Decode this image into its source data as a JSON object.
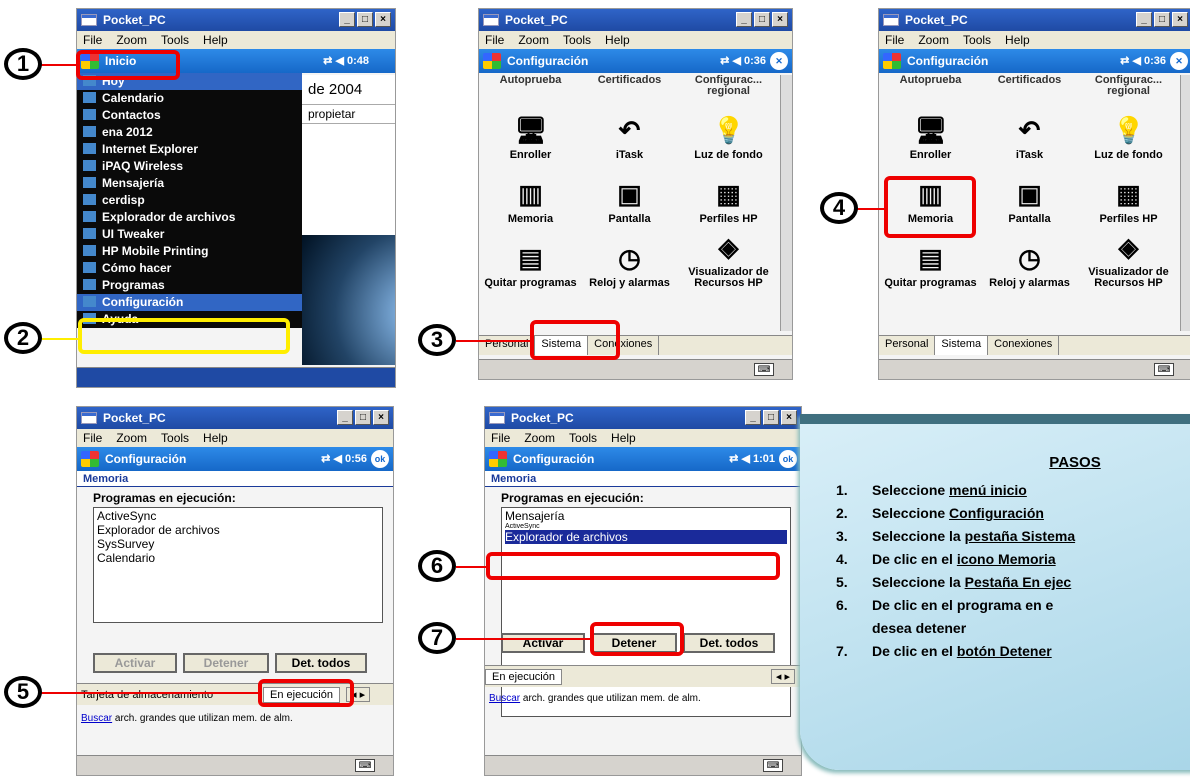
{
  "window": {
    "title": "Pocket_PC",
    "menu": [
      "File",
      "Zoom",
      "Tools",
      "Help"
    ]
  },
  "s1": {
    "bar_title": "Inicio",
    "time": "0:48",
    "menu_items": [
      "Hoy",
      "Calendario",
      "Contactos",
      "ena 2012",
      "Internet Explorer",
      "iPAQ Wireless",
      "Mensajería",
      "cerdisp",
      "Explorador de archivos",
      "UI Tweaker",
      "HP Mobile Printing",
      "Cómo hacer",
      "Programas",
      "Configuración",
      "Ayuda"
    ],
    "selected": "Configuración",
    "bg_date": "de 2004",
    "bg_owner": "propietar"
  },
  "cfg": {
    "bar_title": "Configuración",
    "time_s2": "0:36",
    "time_s4": "0:56",
    "time_s5": "1:01",
    "ok": "ok",
    "icons": [
      {
        "label": "Autoprueba",
        "icon": "ic-top"
      },
      {
        "label": "Certificados",
        "icon": "ic-top"
      },
      {
        "label": "Configurac... regional",
        "icon": "ic-top"
      },
      {
        "label": "Enroller",
        "icon": "hp-icon"
      },
      {
        "label": "iTask",
        "icon": "arrow-icon"
      },
      {
        "label": "Luz de fondo",
        "icon": "light-icon"
      },
      {
        "label": "Memoria",
        "icon": "memory-icon"
      },
      {
        "label": "Pantalla",
        "icon": "screen-icon"
      },
      {
        "label": "Perfiles HP",
        "icon": "profiles-icon"
      },
      {
        "label": "Quitar programas",
        "icon": "remove-icon"
      },
      {
        "label": "Reloj y alarmas",
        "icon": "clock-icon"
      },
      {
        "label": "Visualizador de Recursos HP",
        "icon": "viewer-icon"
      }
    ],
    "tabs": [
      "Personal",
      "Sistema",
      "Conexiones"
    ]
  },
  "mem": {
    "header": "Memoria",
    "label": "Programas en ejecución:",
    "list_s4": [
      "ActiveSync",
      "Explorador de archivos",
      "SysSurvey",
      "Calendario"
    ],
    "list_s5": [
      "Mensajería",
      "ActiveSync",
      "Explorador de archivos"
    ],
    "buttons": [
      "Activar",
      "Detener",
      "Det. todos"
    ],
    "tab_left": "Tarjeta de almacenamiento",
    "tab_active": "En ejecución",
    "link_word": "Buscar",
    "link_rest": " arch. grandes que utilizan mem. de alm."
  },
  "markers": [
    "1",
    "2",
    "3",
    "4",
    "5",
    "6",
    "7"
  ],
  "panel": {
    "title": "PASOS",
    "steps": [
      {
        "n": "1.",
        "pre": "Seleccione ",
        "u": "menú inicio",
        "post": ""
      },
      {
        "n": "2.",
        "pre": "Seleccione ",
        "u": "Configuración",
        "post": ""
      },
      {
        "n": "3.",
        "pre": "Seleccione la ",
        "u": "pestaña Sistema",
        "post": ""
      },
      {
        "n": "4.",
        "pre": "De clic en el ",
        "u": "icono Memoria",
        "post": ""
      },
      {
        "n": "5.",
        "pre": "Seleccione la ",
        "u": "Pestaña En ejec",
        "post": ""
      },
      {
        "n": "6.",
        "pre": "De clic en el programa en e",
        "u": "",
        "post": ""
      },
      {
        "n": "",
        "pre": "desea detener",
        "u": "",
        "post": ""
      },
      {
        "n": "7.",
        "pre": "De clic en el ",
        "u": "botón Detener",
        "post": ""
      }
    ]
  },
  "colors": {
    "highlight": "#e00000",
    "yellow_box": "#ffee00",
    "title_bar": "#1f4aa4"
  }
}
